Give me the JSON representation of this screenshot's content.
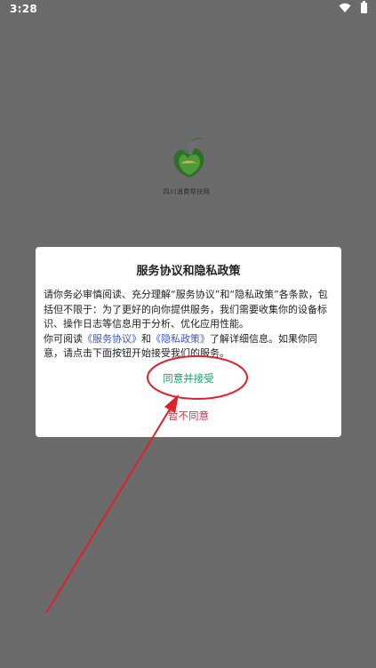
{
  "status_bar": {
    "time": "3:28",
    "wifi_icon": "wifi-icon",
    "battery_icon": "battery-icon"
  },
  "splash": {
    "logo_icon": "leaf-logo-icon",
    "caption": "四川消费帮扶网"
  },
  "dialog": {
    "title": "服务协议和隐私政策",
    "para1": "请你务必审慎阅读、充分理解“服务协议”和“隐私政策”各条款，包括但不限于：为了更好的向你提供服务，我们需要收集你的设备标识、操作日志等信息用于分析、优化应用性能。",
    "para2_prefix": "你可阅读",
    "service_link": "《服务协议》",
    "and_text": "和",
    "privacy_link": "《隐私政策》",
    "para2_suffix": "了解详细信息。如果你同意，请点击下面按钮开始接受我们的服务。",
    "agree_label": "同意并接受",
    "disagree_label": "暂不同意"
  },
  "colors": {
    "overlay": "#6b6b6b",
    "agree": "#1f9b6a",
    "disagree": "#d7334a",
    "link": "#3a55d6",
    "annotation": "#e0202a"
  }
}
